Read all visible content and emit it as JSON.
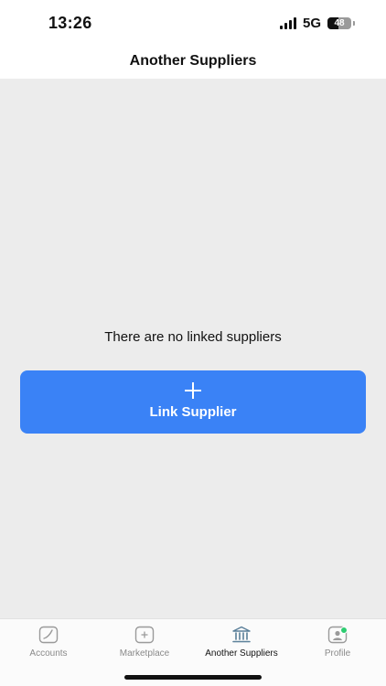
{
  "status_bar": {
    "time": "13:26",
    "network": "5G",
    "battery": "48"
  },
  "header": {
    "title": "Another Suppliers"
  },
  "main": {
    "empty_message": "There are no linked suppliers",
    "link_button_label": "Link Supplier"
  },
  "tab_bar": {
    "tabs": [
      {
        "label": "Accounts",
        "icon": "chart-icon"
      },
      {
        "label": "Marketplace",
        "icon": "plus-box-icon"
      },
      {
        "label": "Another Suppliers",
        "icon": "bank-icon",
        "active": true
      },
      {
        "label": "Profile",
        "icon": "profile-icon",
        "badge": true
      }
    ]
  },
  "colors": {
    "accent": "#3a82f6",
    "badge": "#2ecc71",
    "background": "#ececec"
  }
}
